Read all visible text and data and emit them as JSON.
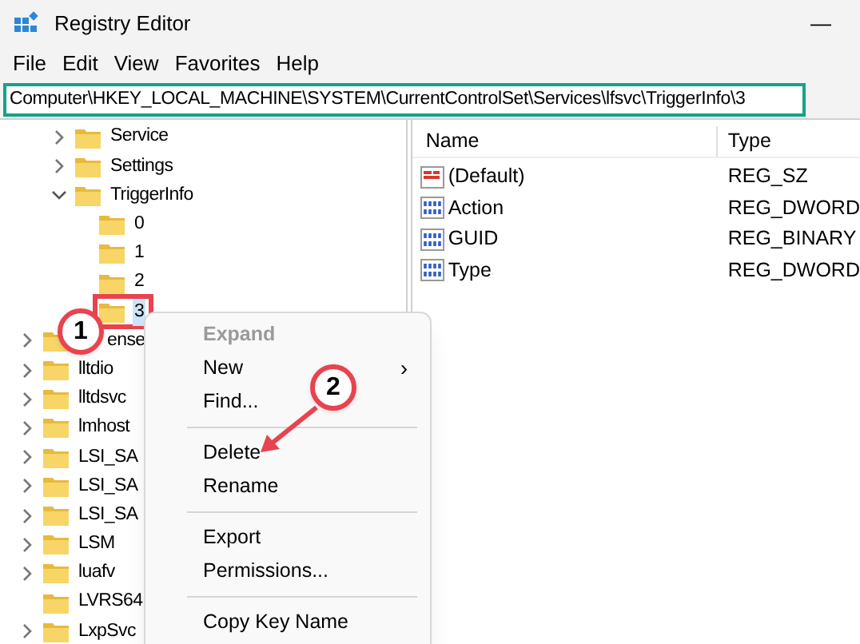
{
  "window": {
    "title": "Registry Editor",
    "minimize": "—"
  },
  "menu_bar": [
    "File",
    "Edit",
    "View",
    "Favorites",
    "Help"
  ],
  "address": "Computer\\HKEY_LOCAL_MACHINE\\SYSTEM\\CurrentControlSet\\Services\\lfsvc\\TriggerInfo\\3",
  "tree": {
    "branch": [
      {
        "label": "Service",
        "expanded": false,
        "selected": false
      },
      {
        "label": "Settings",
        "expanded": false,
        "selected": false
      },
      {
        "label": "TriggerInfo",
        "expanded": true,
        "selected": false,
        "children": [
          {
            "label": "0",
            "selected": false,
            "highlighted": false
          },
          {
            "label": "1",
            "selected": false,
            "highlighted": false
          },
          {
            "label": "2",
            "selected": false,
            "highlighted": false
          },
          {
            "label": "3",
            "selected": true,
            "highlighted": true
          }
        ]
      }
    ],
    "items": [
      {
        "label": "ense",
        "expanded": false,
        "selected": false,
        "kind": "covered"
      },
      {
        "label": "lltdio",
        "expanded": false,
        "selected": false,
        "kind": "plain"
      },
      {
        "label": "lltdsvc",
        "expanded": false,
        "selected": false,
        "kind": "plain"
      },
      {
        "label": "lmhost",
        "expanded": false,
        "selected": false,
        "kind": "plain"
      },
      {
        "label": "LSI_SA",
        "expanded": false,
        "selected": false,
        "kind": "plain"
      },
      {
        "label": "LSI_SA",
        "expanded": false,
        "selected": false,
        "kind": "plain"
      },
      {
        "label": "LSI_SA",
        "expanded": false,
        "selected": false,
        "kind": "plain"
      },
      {
        "label": "LSM",
        "expanded": false,
        "selected": false,
        "kind": "plain"
      },
      {
        "label": "luafv",
        "expanded": false,
        "selected": false,
        "kind": "plain"
      },
      {
        "label": "LVRS64",
        "selected": false,
        "kind": "plain"
      },
      {
        "label": "LxpSvc",
        "expanded": false,
        "selected": false,
        "kind": "plain"
      }
    ]
  },
  "values": {
    "columns": [
      "Name",
      "Type"
    ],
    "rows": [
      {
        "name": "(Default)",
        "type": "REG_SZ",
        "kind": "string"
      },
      {
        "name": "Action",
        "type": "REG_DWORD",
        "kind": "binary"
      },
      {
        "name": "GUID",
        "type": "REG_BINARY",
        "kind": "binary"
      },
      {
        "name": "Type",
        "type": "REG_DWORD",
        "kind": "binary"
      }
    ]
  },
  "context_menu": [
    {
      "label": "Expand",
      "kind": "item",
      "disabled": true
    },
    {
      "label": "New",
      "kind": "submenu",
      "disabled": false,
      "chevron": "›"
    },
    {
      "label": "Find...",
      "kind": "item",
      "disabled": false
    },
    {
      "kind": "separator"
    },
    {
      "label": "Delete",
      "kind": "item",
      "disabled": false
    },
    {
      "label": "Rename",
      "kind": "item",
      "disabled": false
    },
    {
      "kind": "separator"
    },
    {
      "label": "Export",
      "kind": "item",
      "disabled": false
    },
    {
      "label": "Permissions...",
      "kind": "item",
      "disabled": false
    },
    {
      "kind": "separator"
    },
    {
      "label": "Copy Key Name",
      "kind": "item",
      "disabled": false
    }
  ],
  "annotations": [
    {
      "label": "1"
    },
    {
      "label": "2"
    }
  ]
}
